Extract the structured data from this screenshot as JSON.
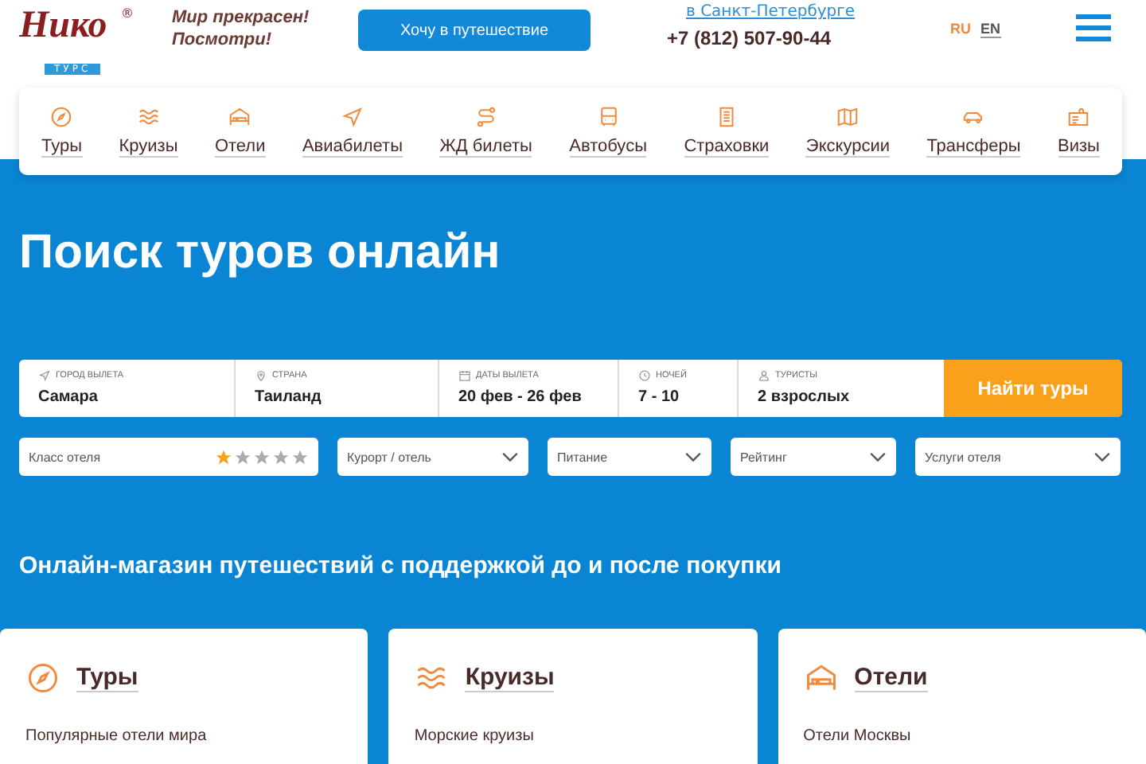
{
  "header": {
    "logo": {
      "name": "Нико",
      "sub": "ТУРС",
      "mark": "®"
    },
    "tagline": [
      "Мир прекрасен!",
      "Посмотри!"
    ],
    "cta_button": "Хочу в путешествие",
    "city_link": "в Санкт-Петербурге",
    "phone": "+7 (812) 507-90-44",
    "languages": [
      {
        "label": "RU",
        "selected": true
      },
      {
        "label": "EN",
        "selected": false
      }
    ]
  },
  "nav": [
    {
      "label": "Туры"
    },
    {
      "label": "Круизы"
    },
    {
      "label": "Отели"
    },
    {
      "label": "Авиабилеты"
    },
    {
      "label": "ЖД билеты"
    },
    {
      "label": "Автобусы"
    },
    {
      "label": "Страховки"
    },
    {
      "label": "Экскурсии"
    },
    {
      "label": "Трансферы"
    },
    {
      "label": "Визы"
    }
  ],
  "hero_title": "Поиск туров онлайн",
  "search": {
    "fields": [
      {
        "label": "ГОРОД ВЫЛЕТА",
        "value": "Самара"
      },
      {
        "label": "СТРАНА",
        "value": "Таиланд"
      },
      {
        "label": "ДАТЫ ВЫЛЕТА",
        "value": "20 фев - 26 фев"
      },
      {
        "label": "НОЧЕЙ",
        "value": "7 - 10"
      },
      {
        "label": "ТУРИСТЫ",
        "value": "2 взрослых"
      }
    ],
    "submit": "Найти туры"
  },
  "filters": [
    {
      "kind": "stars",
      "label": "Класс отеля",
      "stars": 1
    },
    {
      "kind": "select",
      "label": "Курорт / отель"
    },
    {
      "kind": "select",
      "label": "Питание"
    },
    {
      "kind": "select",
      "label": "Рейтинг"
    },
    {
      "kind": "select",
      "label": "Услуги отеля"
    }
  ],
  "tagline": "Онлайн-магазин путешествий с поддержкой до и после покупки",
  "cards": [
    {
      "title": "Туры",
      "link": "Популярные отели мира"
    },
    {
      "title": "Круизы",
      "link": "Морские круизы"
    },
    {
      "title": "Отели",
      "link": "Отели Москвы"
    }
  ]
}
